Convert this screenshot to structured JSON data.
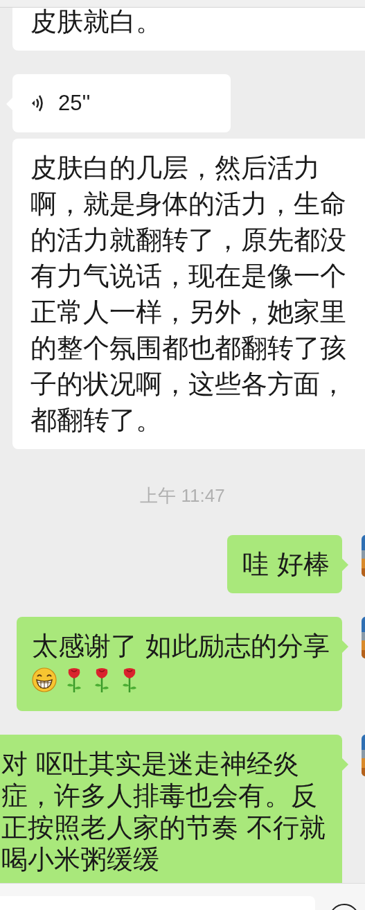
{
  "messages": [
    {
      "kind": "received_text",
      "tail": false,
      "text": "皮肤就白。"
    },
    {
      "kind": "received_voice",
      "tail": true,
      "duration": "25''"
    },
    {
      "kind": "received_text",
      "tail": false,
      "text": "皮肤白的几层，然后活力啊，就是身体的活力，生命的活力就翻转了，原先都没有力气说话，现在是像一个正常人一样，另外，她家里的整个氛围都也都翻转了孩子的状况啊，这些各方面，都翻转了。"
    },
    {
      "kind": "time",
      "text": "上午 11:47"
    },
    {
      "kind": "sent_text",
      "tail": true,
      "text": "哇 好棒"
    },
    {
      "kind": "sent_text_with_emoji",
      "tail": true,
      "text": "太感谢了 如此励志的分享"
    },
    {
      "kind": "sent_text",
      "tail": true,
      "text": "对 呕吐其实是迷走神经炎症，许多人排毒也会有。反正按照老人家的节奏 不行就喝小米粥缓缓"
    }
  ]
}
